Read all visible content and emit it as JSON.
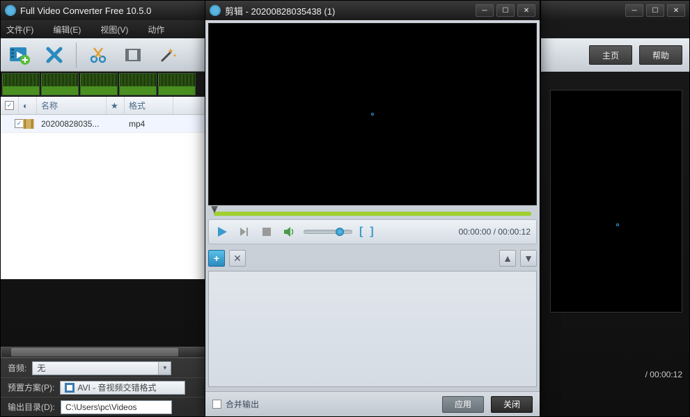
{
  "main": {
    "title": "Full Video Converter Free 10.5.0",
    "menu": {
      "file": "文件(F)",
      "edit": "编辑(E)",
      "view": "视图(V)",
      "action": "动作"
    },
    "list": {
      "cols": {
        "name": "名称",
        "format": "格式"
      },
      "row": {
        "name": "20200828035...",
        "format": "mp4"
      }
    },
    "audio_label": "音频:",
    "audio_value": "无",
    "preset_label": "预置方案(P):",
    "preset_value": "AVI - 音视频交错格式",
    "output_label": "输出目录(D):",
    "output_value": "C:\\Users\\pc\\Videos"
  },
  "side": {
    "home": "主页",
    "help": "帮助",
    "time": "/ 00:00:12"
  },
  "modal": {
    "title": "剪辑 - 20200828035438 (1)",
    "time": "00:00:00 / 00:00:12",
    "merge": "合并输出",
    "apply": "应用",
    "close": "关闭"
  }
}
